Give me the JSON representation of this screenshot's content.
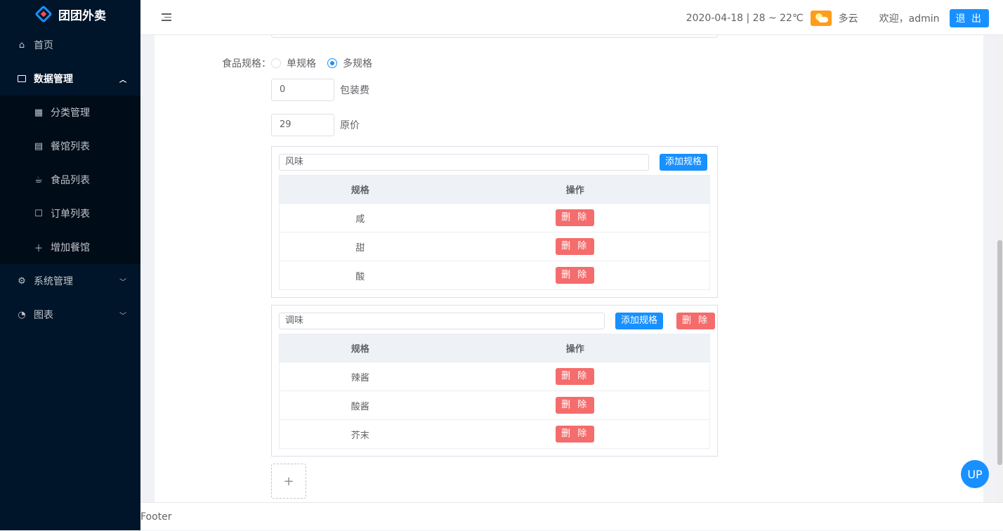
{
  "app": {
    "title": "团团外卖"
  },
  "sidebar": {
    "items": [
      {
        "label": "首页",
        "icon": "home-icon"
      },
      {
        "label": "数据管理",
        "icon": "laptop-icon",
        "expanded": true,
        "children": [
          {
            "label": "分类管理",
            "icon": "grid-icon"
          },
          {
            "label": "餐馆列表",
            "icon": "shop-icon"
          },
          {
            "label": "食品列表",
            "icon": "cup-icon"
          },
          {
            "label": "订单列表",
            "icon": "order-icon"
          },
          {
            "label": "增加餐馆",
            "icon": "plus-icon"
          }
        ]
      },
      {
        "label": "系统管理",
        "icon": "gear-icon"
      },
      {
        "label": "图表",
        "icon": "pie-chart-icon"
      }
    ]
  },
  "header": {
    "weather_text": "2020-04-18 | 28 ~ 22℃",
    "weather_desc": "多云",
    "welcome": "欢迎，admin",
    "logout_label": "退 出"
  },
  "form": {
    "spec_label": "食品规格：",
    "radio_single": "单规格",
    "radio_multi": "多规格",
    "radio_selected": "多规格",
    "packing_value": "0",
    "packing_label": "包装费",
    "price_value": "29",
    "price_label": "原价",
    "add_spec_label": "添加规格",
    "delete_label": "删 除",
    "col_spec": "规格",
    "col_action": "操作",
    "groups": [
      {
        "name": "风味",
        "items": [
          "咸",
          "甜",
          "酸"
        ]
      },
      {
        "name": "调味",
        "items": [
          "辣酱",
          "酸酱",
          "芥末"
        ]
      }
    ]
  },
  "up_label": "UP",
  "footer": {
    "text": "Footer"
  },
  "colors": {
    "primary": "#1890ff",
    "danger": "#f56c6c",
    "sidebar_bg": "#001529"
  }
}
